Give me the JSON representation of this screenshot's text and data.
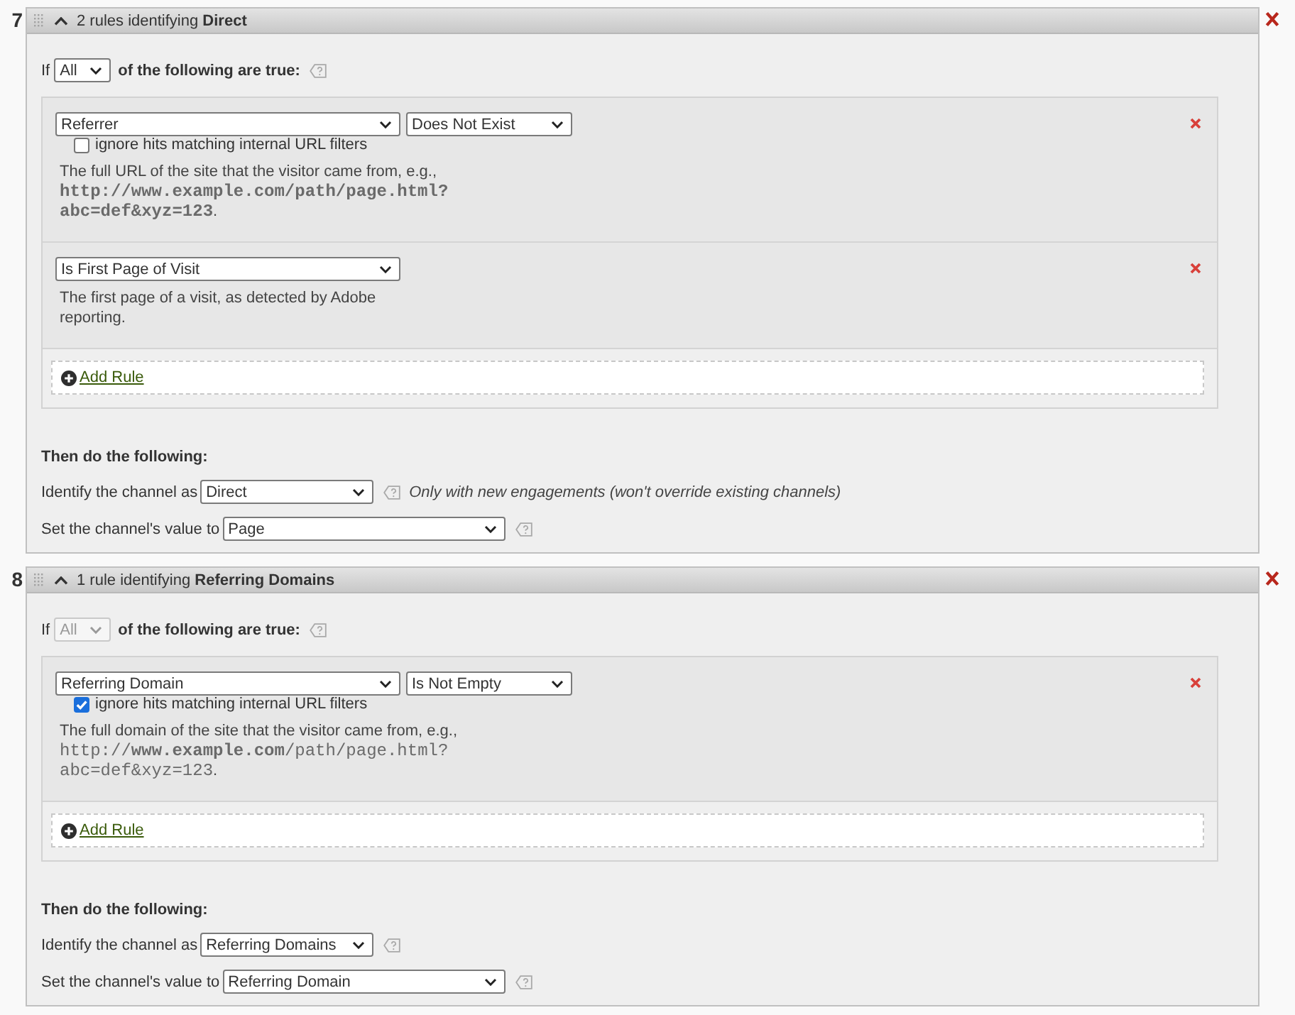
{
  "rule_sets": [
    {
      "number": "7",
      "title": "2 rules identifying **Direct**",
      "expanded": true,
      "match": {
        "prefix": "If",
        "value": "All",
        "disabled": false,
        "suffix": "of the following are true:"
      },
      "rules": [
        {
          "field": "Referrer",
          "operator": "Does Not Exist",
          "ignore_internal": {
            "label": "ignore hits matching internal URL filters",
            "checked": false
          },
          "description": [
            {
              "kind": "text",
              "text": "The full URL of the site that the visitor came from, e.g.,"
            },
            {
              "kind": "code",
              "text": "**http://www.example.com/path/page.html?abc=def&xyz=123**"
            },
            {
              "kind": "text",
              "text": "."
            }
          ]
        },
        {
          "field": "Is First Page of Visit",
          "description": [
            {
              "kind": "text",
              "text": "The first page of a visit, as detected by Adobe reporting."
            }
          ]
        }
      ],
      "add_rule": "Add Rule",
      "actions_heading": "Then do the following:",
      "channel": {
        "label": "Identify the channel as",
        "value": "Direct",
        "note": "Only with new engagements (won't override existing channels)"
      },
      "channel_value": {
        "label": "Set the channel's value to",
        "value": "Page"
      }
    },
    {
      "number": "8",
      "title": "1 rule identifying **Referring Domains**",
      "expanded": true,
      "match": {
        "prefix": "If",
        "value": "All",
        "disabled": true,
        "suffix": "of the following are true:"
      },
      "rules": [
        {
          "field": "Referring Domain",
          "operator": "Is Not Empty",
          "ignore_internal": {
            "label": "ignore hits matching internal URL filters",
            "checked": true
          },
          "description": [
            {
              "kind": "text",
              "text": "The full domain of the site that the visitor came from, e.g.,"
            },
            {
              "kind": "code",
              "text": "http://**www.example.com**/path/page.html?abc=def&xyz=123"
            },
            {
              "kind": "text",
              "text": "."
            }
          ]
        }
      ],
      "add_rule": "Add Rule",
      "actions_heading": "Then do the following:",
      "channel": {
        "label": "Identify the channel as",
        "value": "Referring Domains"
      },
      "channel_value": {
        "label": "Set the channel's value to",
        "value": "Referring Domain"
      }
    }
  ]
}
